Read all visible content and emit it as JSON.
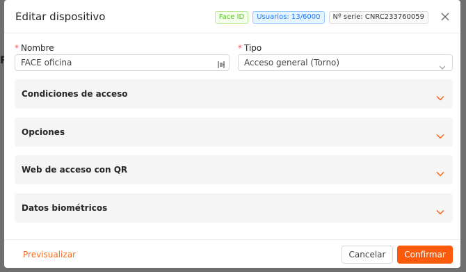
{
  "backdrop": {
    "visible_char": "R"
  },
  "modal": {
    "title": "Editar dispositivo",
    "tags": {
      "face_id": "Face ID",
      "usuarios": "Usuarios: 13/6000",
      "serie": "Nº serie: CNRC233760059"
    },
    "close_icon": "close-icon"
  },
  "form": {
    "nombre": {
      "label": "Nombre",
      "required_mark": "*",
      "value": "FACE oficina"
    },
    "tipo": {
      "label": "Tipo",
      "required_mark": "*",
      "value": "Acceso general (Torno)"
    }
  },
  "panels": [
    {
      "label": "Condiciones de acceso"
    },
    {
      "label": "Opciones"
    },
    {
      "label": "Web de acceso con QR"
    },
    {
      "label": "Datos biométricos"
    }
  ],
  "footer": {
    "preview_label": "Previsualizar",
    "cancel_label": "Cancelar",
    "confirm_label": "Confirmar"
  },
  "colors": {
    "accent": "#fa5a0a",
    "tag_green": "#52c41a",
    "tag_blue": "#1677ff",
    "required": "#ff4d4f"
  }
}
